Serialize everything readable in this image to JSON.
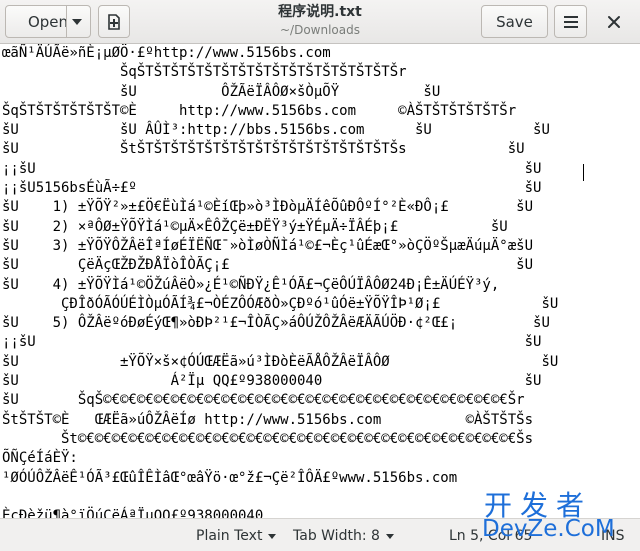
{
  "window": {
    "title": "程序说明.txt",
    "subtitle": "~/Downloads"
  },
  "header": {
    "open_label": "Open",
    "save_label": "Save"
  },
  "icons": {
    "open_dropdown": "chevron-down-icon",
    "new_document": "new-document-icon",
    "menu": "hamburger-menu-icon",
    "close": "close-icon"
  },
  "document": {
    "lines": [
      "œãÑ¹ÄÚÃë»ñÈ¡µØÖ·£ºhttp://www.5156bs.com",
      "              ŠqŠTŠTŠTŠTŠTŠTŠTŠTŠTŠTŠTŠTŠTŠTŠTŠr",
      "              šU          ÔŽÃëÏÂÔØ×šÒµÕŸ          šU",
      "ŠqŠTŠTŠTŠTŠTŠT©È     http://www.5156bs.com     ©ÀŠTŠTŠTŠTŠTŠr",
      "šU            šU ÂÛÌ³:http://bbs.5156bs.com      šU            šU",
      "šU            ŠtŠTŠTŠTŠTŠTŠTŠTŠTŠTŠTŠTŠTŠTŠTŠTŠs            šU",
      "¡¡šU                                                          šU",
      "¡¡šU5156bsÉùÃ÷£º                                              šU",
      "šU    1) ±ŸÕŸ²»±£Ö€ËùÌá¹©ÈíŒþ»ò³ÌÐòµÄÍêÕûÐÔºÍ°²È«ÐÔ¡£        šU",
      "šU    2) ×ªÔØ±ŸÕŸÌá¹©µÄ×ÊÔŽÇë±ÐËŸ³ý±ŸÉµÄ÷ÏÂÉþ¡£           šU",
      "šU    3) ±ŸÕŸÔŽÂëÎªÍøÉÏËÑŒ¯»òÌøÒÑÌá¹©£¬Èç¹ûÉæŒ°»òÇÖºŠµæÄúµÄ°æšU",
      "šU       ÇëÄçŒŽÐŽÐÅÏòÎÒÃÇ¡£                                  šU",
      "šU    4) ±ŸÕŸÌá¹©ÖŽúÂëÒ»¿É¹©ÑÐŸ¿Ê¹ÓÃ£¬ÇëÔÚÏÂÔØ24Ð¡Ê±ÄÚÉŸ³ý,",
      "       ÇÐÎðÓÃÓÚÉÌÒµÓÃÍ¾£¬ÒÉZÔÓÆðÒ»ÇÐºó¹ûÓë±ŸÕŸÎÞ¹Ø¡£            šU",
      "šU    5) ÔŽÂëºóÐøÉýŒ¶»òÐÞ²¹£¬ÎÒÃÇ»áÔÚŽÔŽÂëÆÄÃÚÖÐ·¢²Œ£¡         šU",
      "¡¡šU                                                          šU",
      "šU            ±ŸÕŸ×š×¢ÓÚŒÆËã»ú³ÌÐòÈëÃÅÔŽÂëÏÂÔØ                  šU",
      "šU                  Á²Ïµ QQ£º938000040                        šU",
      "šU       ŠqŠ©€©€©€©€©€©€©€©€©€©€©€©€©€©€©€©€©€©€©€©€©€©€©€©€Šr",
      "ŠtŠTŠT©È   ŒÆËã»úÔŽÂëÍø http://www.5156bs.com          ©ÀŠTŠTŠs",
      "       Št©€©€©€©€©€©€©€©€©€©€©€©€©€©€©€©€©€©€©€©€©€©€©€©€©€©€Šs",
      "ÕÑÇéÍáÈŸ:",
      "¹ØÓÚÔŽÂëÊ¹ÓÃ³£ŒûÎÊÌâŒ°œâŸö·œ°ž£¬Çë²ÎÔÄ£ºwww.5156bs.com",
      "",
      "ÈçÐèžü¶à°ïÖúÇëÁªÏµQQ£º938000040"
    ]
  },
  "statusbar": {
    "language": "Plain Text",
    "tab_width": "Tab Width: 8",
    "position": "Ln 5, Col 65",
    "mode": "INS"
  },
  "watermark": {
    "top": "开发者",
    "bottom": "DevZe.CoM"
  }
}
